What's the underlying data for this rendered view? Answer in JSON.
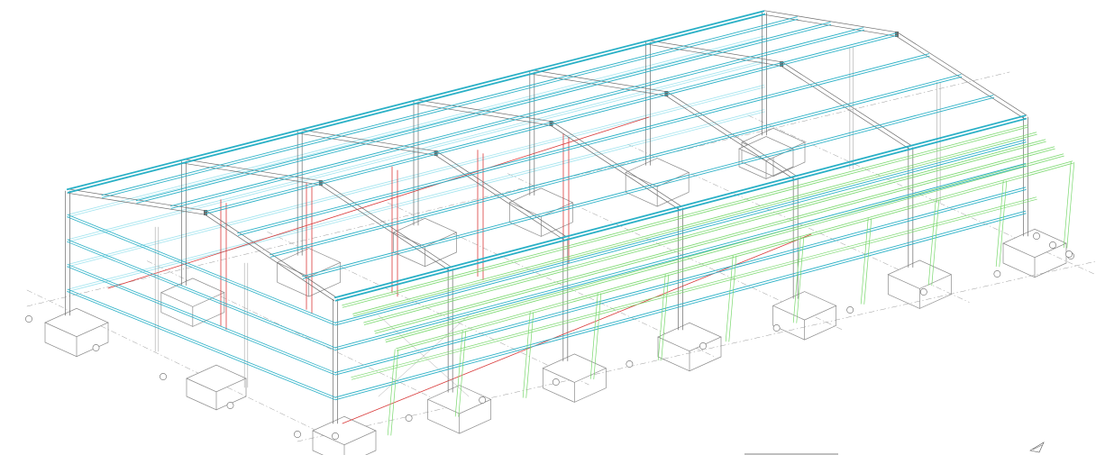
{
  "colors": {
    "background": "#ffffff",
    "steel": "#6b6b6b",
    "steel_light": "#a8a8a8",
    "purlin_cyan": "#2ab0c6",
    "purlin_cyan_light": "#9fe3ee",
    "canopy_green": "#79d86d",
    "bracing_red": "#d93a3a",
    "footing": "#8a8a8a",
    "gridline": "#9a9a9a"
  },
  "icons": {
    "north_arrow": "north-arrow-icon"
  },
  "grid_bubbles": {
    "front_labels": [
      "",
      "",
      "",
      "",
      "",
      "",
      "",
      "",
      "",
      "",
      ""
    ],
    "left_labels": [
      "",
      "",
      "",
      "",
      ""
    ],
    "right_labels": [
      "",
      "",
      ""
    ]
  }
}
